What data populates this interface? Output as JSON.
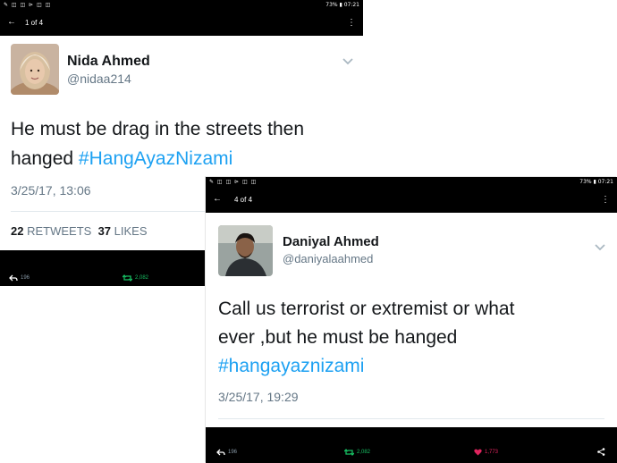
{
  "screens": [
    {
      "status": {
        "left_icons": "✎ ◫ ◫ ⊳ ◫ ◫",
        "right_text": "73% ▮ 07:21"
      },
      "nav": {
        "back_icon": "←",
        "pager": "1 of 4",
        "more_icon": "⋮"
      },
      "tweet": {
        "name": "Nida Ahmed",
        "handle": "@nidaa214",
        "text_line1": "He must be drag in the streets then",
        "text_line2_pre": "hanged ",
        "hashtag": "#HangAyazNizami",
        "timestamp": "3/25/17, 13:06",
        "retweets_count": "22",
        "retweets_label": "RETWEETS",
        "likes_count": "37",
        "likes_label": "LIKES"
      },
      "actions": {
        "reply_count": "196",
        "retweet_count": "2,082"
      }
    },
    {
      "status": {
        "left_icons": "✎ ◫ ◫ ⊳ ◫ ◫",
        "right_text": "73% ▮ 07:21"
      },
      "nav": {
        "back_icon": "←",
        "pager": "4 of 4",
        "more_icon": "⋮"
      },
      "tweet": {
        "name": "Daniyal Ahmed",
        "handle": "@daniyalaahmed",
        "text_line1": "Call us terrorist or extremist or what",
        "text_line2": "ever ,but he must be hanged",
        "hashtag": "#hangayaznizami",
        "timestamp": "3/25/17, 19:29"
      },
      "actions": {
        "reply_count": "196",
        "retweet_count": "2,082",
        "like_count": "1,773"
      }
    }
  ],
  "colors": {
    "link": "#1da1f2",
    "text": "#14171a",
    "secondary": "#657786",
    "retweet": "#17bf63",
    "like": "#e0245e"
  }
}
